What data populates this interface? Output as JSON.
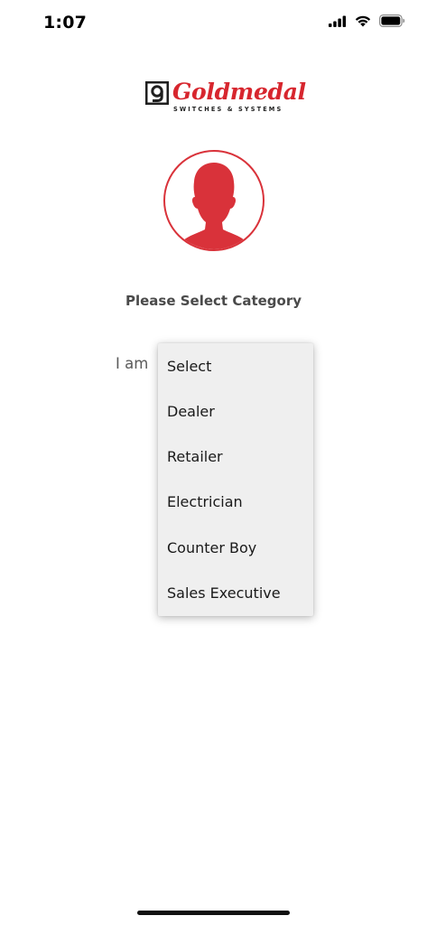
{
  "status_bar": {
    "time": "1:07",
    "icons": [
      "cellular-signal-icon",
      "wifi-icon",
      "battery-icon"
    ]
  },
  "brand": {
    "name": "Goldmedal",
    "tagline": "SWITCHES & SYSTEMS",
    "color": "#d7262e"
  },
  "avatar": {
    "icon": "user-silhouette-icon",
    "color": "#d9323a"
  },
  "form": {
    "heading": "Please Select Category",
    "field_label": "I am",
    "dropdown": {
      "options": [
        "Select",
        "Dealer",
        "Retailer",
        "Electrician",
        "Counter Boy",
        "Sales Executive"
      ],
      "selected": "Select"
    }
  }
}
